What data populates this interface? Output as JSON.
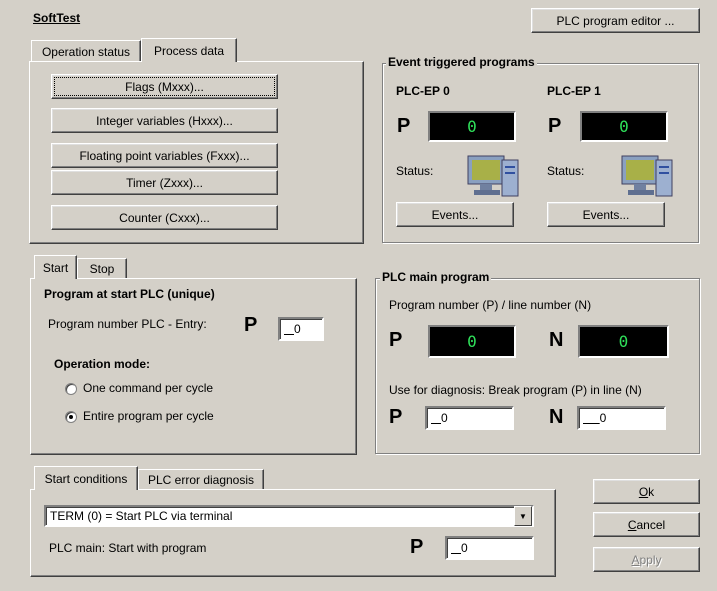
{
  "title": "SoftTest",
  "plc_editor_button": "PLC program editor ...",
  "top_tabs": [
    "Operation status",
    "Process data"
  ],
  "process_data_buttons": [
    "Flags (Mxxx)...",
    "Integer variables (Hxxx)...",
    "Floating point variables (Fxxx)...",
    "Timer (Zxxx)...",
    "Counter (Cxxx)..."
  ],
  "event_programs": {
    "title": "Event triggered programs",
    "ep0": {
      "label": "PLC-EP 0",
      "p": "P",
      "value": "0",
      "status_label": "Status:",
      "events_button": "Events..."
    },
    "ep1": {
      "label": "PLC-EP 1",
      "p": "P",
      "value": "0",
      "status_label": "Status:",
      "events_button": "Events..."
    }
  },
  "start_stop_tabs": [
    "Start",
    "Stop"
  ],
  "start_panel": {
    "heading": "Program at start PLC (unique)",
    "entry_label": "Program number PLC - Entry:",
    "p": "P",
    "entry_value": "0",
    "mode_label": "Operation mode:",
    "radio_one": "One command per cycle",
    "radio_entire": "Entire program per cycle"
  },
  "main_program": {
    "title": "PLC main program",
    "desc": "Program number (P) / line number (N)",
    "p": "P",
    "n": "N",
    "p_value": "0",
    "n_value": "0",
    "diag_label": "Use for diagnosis: Break program (P) in line (N)",
    "break_p": "0",
    "break_n": "0"
  },
  "bottom_tabs": [
    "Start conditions",
    "PLC error diagnosis"
  ],
  "start_conditions": {
    "select_value": "TERM (0) = Start PLC via terminal",
    "main_label": "PLC main: Start with program",
    "p": "P",
    "main_value": "0"
  },
  "dialog_buttons": {
    "ok": "Ok",
    "cancel": "Cancel",
    "apply": "Apply"
  }
}
